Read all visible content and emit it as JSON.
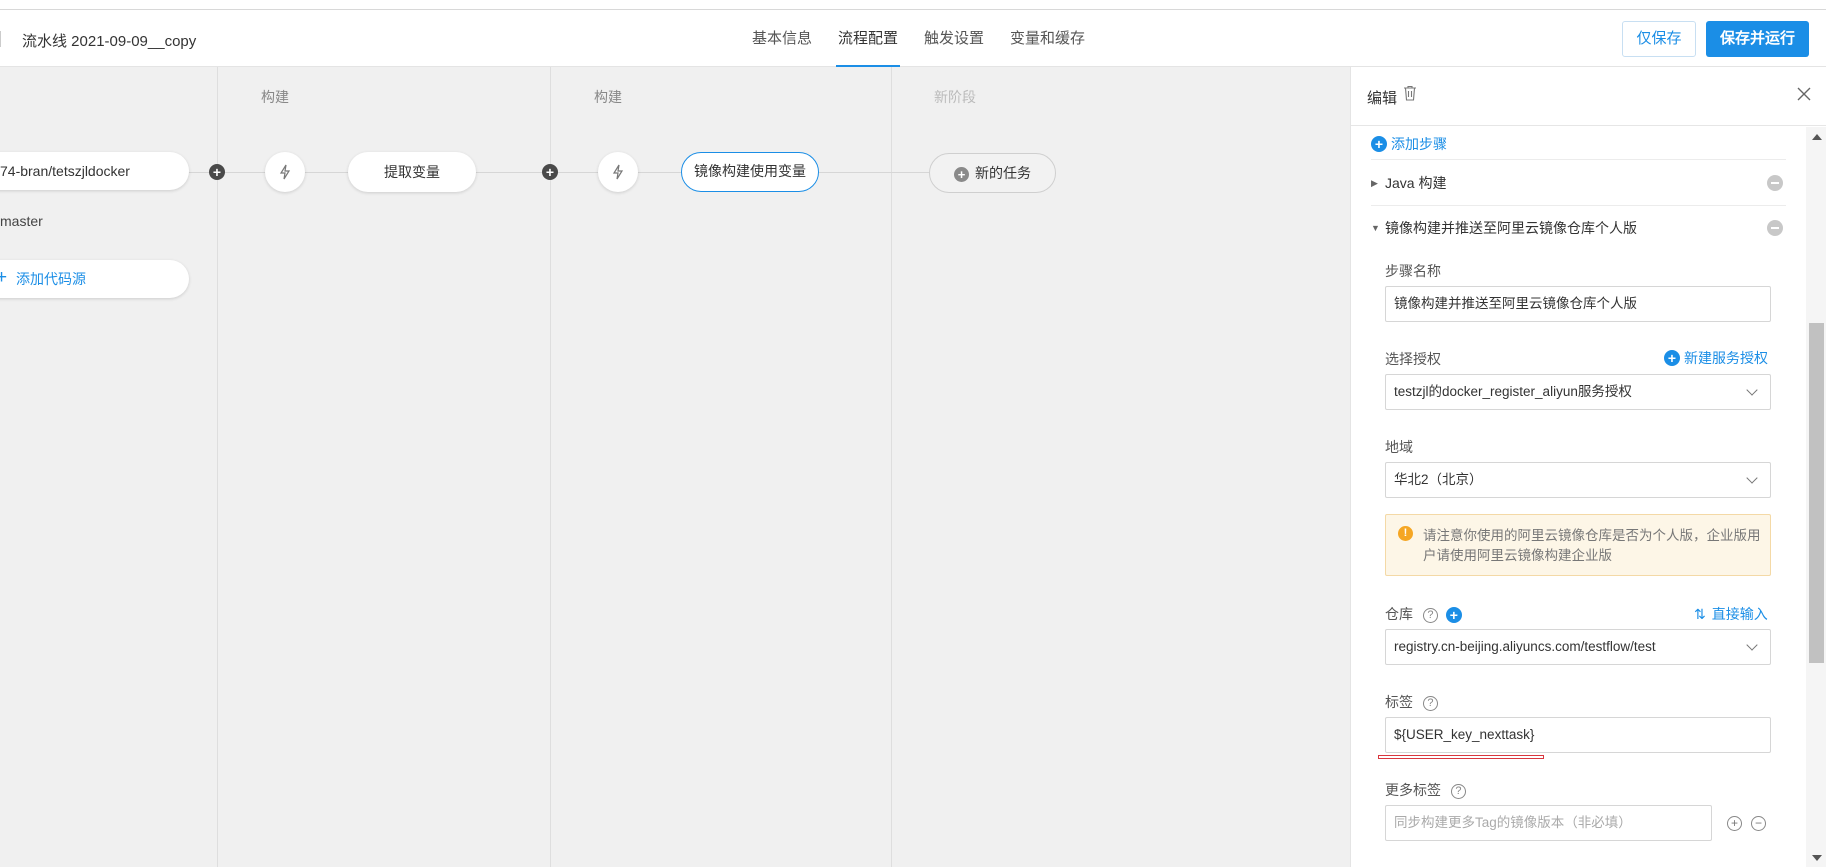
{
  "header": {
    "title": "流水线 2021-09-09__copy",
    "tabs": [
      "基本信息",
      "流程配置",
      "触发设置",
      "变量和缓存"
    ],
    "active_tab": "流程配置",
    "save_label": "仅保存",
    "save_run_label": "保存并运行"
  },
  "canvas": {
    "source": {
      "repo": "74-bran/tetszjldocker",
      "branch": "master",
      "add_label": "添加代码源"
    },
    "stages": [
      {
        "title": "构建",
        "task": "提取变量"
      },
      {
        "title": "构建",
        "task": "镜像构建使用变量"
      },
      {
        "title": "新阶段",
        "task": "新的任务"
      }
    ]
  },
  "panel": {
    "title": "编辑",
    "add_step": "添加步骤",
    "steps": [
      {
        "name": "Java 构建",
        "expanded": false
      },
      {
        "name": "镜像构建并推送至阿里云镜像仓库个人版",
        "expanded": true
      }
    ],
    "form": {
      "step_name_label": "步骤名称",
      "step_name_value": "镜像构建并推送至阿里云镜像仓库个人版",
      "auth_label": "选择授权",
      "auth_new_link": "新建服务授权",
      "auth_value": "testzjl的docker_register_aliyun服务授权",
      "region_label": "地域",
      "region_value": "华北2（北京）",
      "alert_text": "请注意你使用的阿里云镜像仓库是否为个人版，企业版用户请使用阿里云镜像构建企业版",
      "repo_label": "仓库",
      "repo_direct_link": "直接输入",
      "repo_value": "registry.cn-beijing.aliyuncs.com/testflow/test",
      "tag_label": "标签",
      "tag_value": "${USER_key_nexttask}",
      "more_tags_label": "更多标签",
      "more_tags_placeholder": "同步构建更多Tag的镜像版本（非必填）"
    }
  },
  "colors": {
    "accent": "#1b8ee6",
    "warning": "#f5a623",
    "highlight": "#d9363e"
  }
}
